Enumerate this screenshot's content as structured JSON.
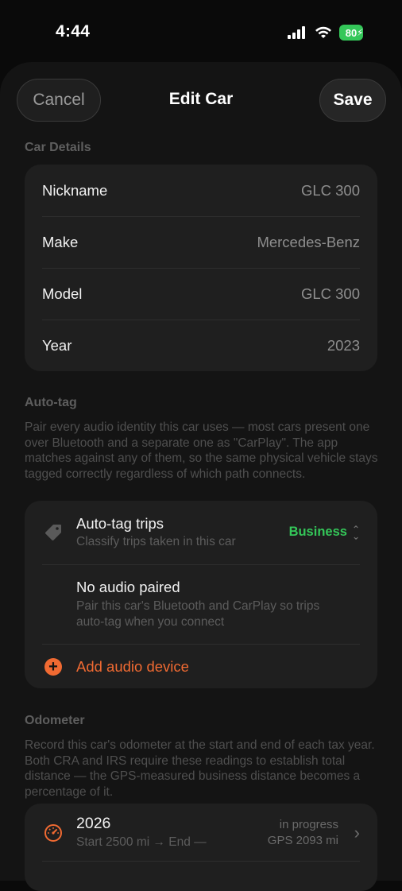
{
  "status_bar": {
    "time": "4:44",
    "battery": "80"
  },
  "nav": {
    "cancel": "Cancel",
    "title": "Edit Car",
    "save": "Save"
  },
  "car_details": {
    "label": "Car Details",
    "rows": [
      {
        "key": "Nickname",
        "value": "GLC 300"
      },
      {
        "key": "Make",
        "value": "Mercedes-Benz"
      },
      {
        "key": "Model",
        "value": "GLC 300"
      },
      {
        "key": "Year",
        "value": "2023"
      }
    ]
  },
  "auto_tag": {
    "label": "Auto-tag",
    "description": "Pair every audio identity this car uses — most cars present one over Bluetooth and a separate one as \"CarPlay\". The app matches against any of them, so the same physical vehicle stays tagged correctly regardless of which path connects.",
    "trips_title": "Auto-tag trips",
    "trips_sub": "Classify trips taken in this car",
    "trips_value": "Business",
    "no_audio_title": "No audio paired",
    "no_audio_sub": "Pair this car's Bluetooth and CarPlay so trips auto-tag when you connect",
    "add_device": "Add audio device"
  },
  "odometer": {
    "label": "Odometer",
    "description": "Record this car's odometer at the start and end of each tax year. Both CRA and IRS require these readings to establish total distance — the GPS-measured business distance becomes a percentage of it.",
    "entries": [
      {
        "year": "2026",
        "range": "Start 2500 mi → End —",
        "status": "in progress",
        "gps": "GPS 2093 mi"
      }
    ]
  },
  "colors": {
    "accent_orange": "#f06a32",
    "accent_green": "#34c759"
  }
}
